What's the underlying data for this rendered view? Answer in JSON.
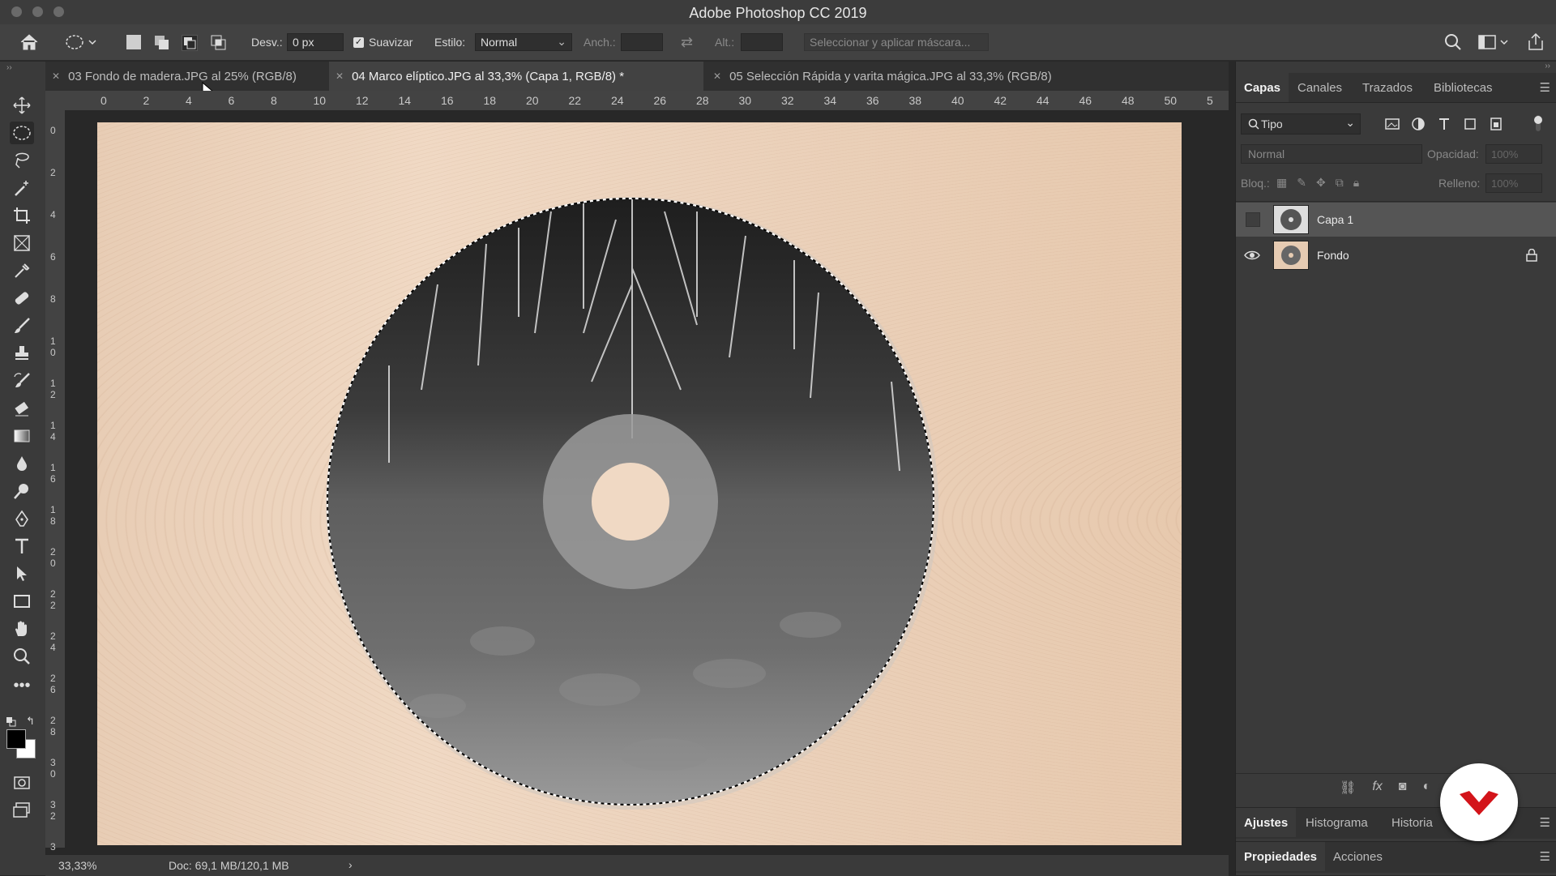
{
  "app": {
    "title": "Adobe Photoshop CC 2019"
  },
  "options": {
    "feather_label": "Desv.:",
    "feather_value": "0 px",
    "antialias_label": "Suavizar",
    "style_label": "Estilo:",
    "style_value": "Normal",
    "width_label": "Anch.:",
    "height_label": "Alt.:",
    "mask_button": "Seleccionar y aplicar máscara..."
  },
  "tabs": [
    {
      "label": "03 Fondo de madera.JPG al 25% (RGB/8)"
    },
    {
      "label": "04 Marco elíptico.JPG al 33,3% (Capa 1, RGB/8) *"
    },
    {
      "label": "05 Selección Rápida y varita mágica.JPG al 33,3% (RGB/8)"
    }
  ],
  "ruler": {
    "top": [
      "0",
      "2",
      "4",
      "6",
      "8",
      "10",
      "12",
      "14",
      "16",
      "18",
      "20",
      "22",
      "24",
      "26",
      "28",
      "30",
      "32",
      "34",
      "36",
      "38",
      "40",
      "42",
      "44",
      "46",
      "48",
      "50",
      "5"
    ],
    "left": [
      "0",
      "2",
      "4",
      "6",
      "8",
      "1\n0",
      "1\n2",
      "1\n4",
      "1\n6",
      "1\n8",
      "2\n0",
      "2\n2",
      "2\n4",
      "2\n6",
      "2\n8",
      "3\n0",
      "3\n2",
      "3"
    ]
  },
  "status": {
    "zoom": "33,33%",
    "doc": "Doc: 69,1 MB/120,1 MB"
  },
  "panel": {
    "tabs": [
      "Capas",
      "Canales",
      "Trazados",
      "Bibliotecas"
    ],
    "filter_value": "Tipo",
    "blend_mode": "Normal",
    "opacity_label": "Opacidad:",
    "opacity_value": "100%",
    "lock_label": "Bloq.:",
    "fill_label": "Relleno:",
    "fill_value": "100%",
    "layers": [
      {
        "name": "Capa 1",
        "visible": false,
        "selected": true
      },
      {
        "name": "Fondo",
        "visible": true,
        "locked": true
      }
    ],
    "bottom_tabs": [
      "Ajustes",
      "Histograma",
      "Historia"
    ],
    "bottom_tabs2": [
      "Propiedades",
      "Acciones"
    ]
  },
  "colors": {
    "accent_logo": "#d3141a",
    "canvas_wood": "#eccfb7"
  }
}
